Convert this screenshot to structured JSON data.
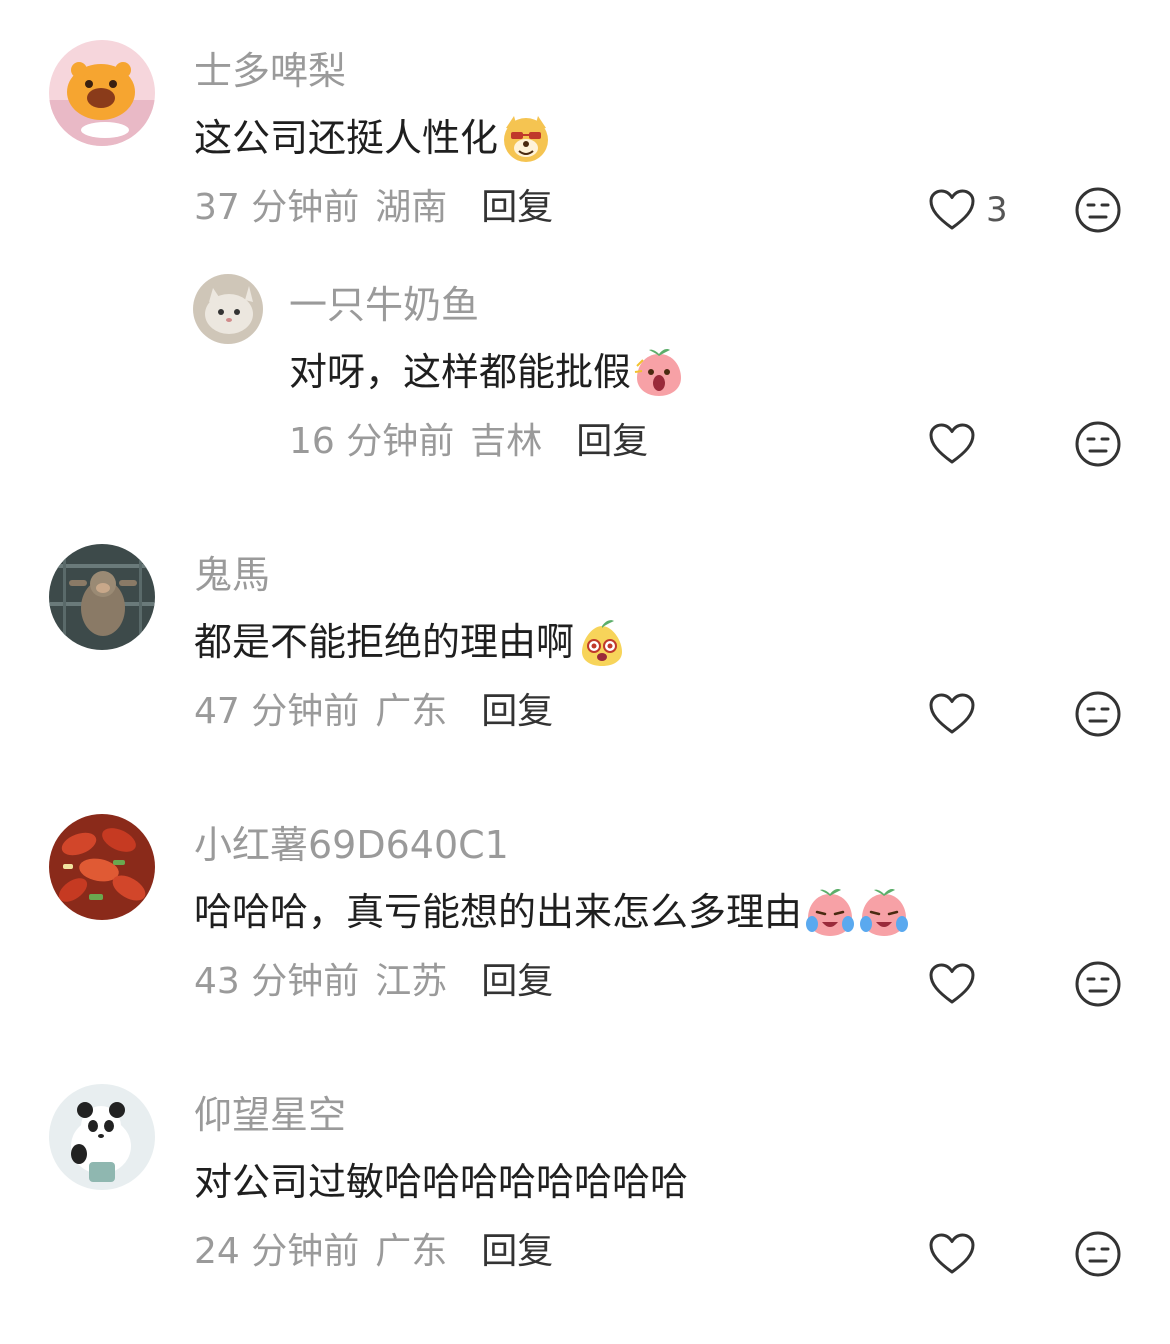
{
  "comments": [
    {
      "username": "士多啤梨",
      "text": "这公司还挺人性化",
      "emoji": [
        "dog-smirk-emoji"
      ],
      "time": "37 分钟前",
      "region": "湖南",
      "reply_label": "回复",
      "like_count": "3"
    },
    {
      "username": "一只牛奶鱼",
      "text": "对呀，这样都能批假",
      "emoji": [
        "peach-shock-emoji"
      ],
      "time": "16 分钟前",
      "region": "吉林",
      "reply_label": "回复",
      "like_count": ""
    },
    {
      "username": "鬼馬",
      "text": "都是不能拒绝的理由啊",
      "emoji": [
        "pear-wow-emoji"
      ],
      "time": "47 分钟前",
      "region": "广东",
      "reply_label": "回复",
      "like_count": ""
    },
    {
      "username": "小红薯69D640C1",
      "text": "哈哈哈，真亏能想的出来怎么多理由",
      "emoji": [
        "peach-laugh-cry-emoji",
        "peach-laugh-cry-emoji"
      ],
      "time": "43 分钟前",
      "region": "江苏",
      "reply_label": "回复",
      "like_count": ""
    },
    {
      "username": "仰望星空",
      "text": "对公司过敏哈哈哈哈哈哈哈哈",
      "emoji": [],
      "time": "24 分钟前",
      "region": "广东",
      "reply_label": "回复",
      "like_count": ""
    }
  ],
  "colors": {
    "username": "#9a9a9a",
    "text": "#1f1f1f",
    "icon": "#333333"
  }
}
